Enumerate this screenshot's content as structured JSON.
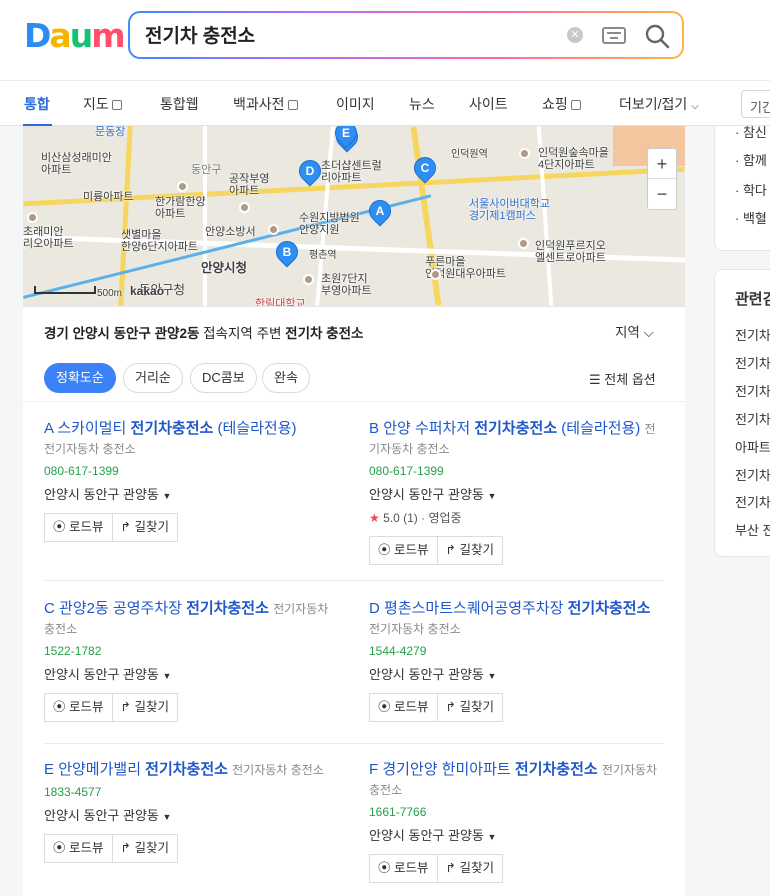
{
  "logo": {
    "text": "Daum"
  },
  "search": {
    "query": "전기차 충전소",
    "clear_icon": "close-icon",
    "keyboard_icon": "keyboard-icon",
    "search_icon": "search-icon"
  },
  "tabs": [
    {
      "label": "통합"
    },
    {
      "label": "지도"
    },
    {
      "label": "통합웹"
    },
    {
      "label": "백과사전"
    },
    {
      "label": "이미지"
    },
    {
      "label": "뉴스"
    },
    {
      "label": "사이트"
    },
    {
      "label": "쇼핑"
    },
    {
      "label": "더보기/접기"
    }
  ],
  "period": {
    "label": "기간"
  },
  "map": {
    "labels": {
      "l1": "문동장",
      "l2": "비산삼성래미안",
      "l2b": "아파트",
      "l3": "동안구",
      "l4": "미륭아파트",
      "l5": "초래미안",
      "l5b": "리오아파트",
      "l6": "한가람한양",
      "l6b": "아파트",
      "l7": "공작부영",
      "l7b": "아파트",
      "l8": "샛별마을",
      "l8b": "한양6단지아파트",
      "l9": "안양소방서",
      "l10": "수원지방법원",
      "l10b": "안양지원",
      "l11": "안양시청",
      "l12": "동안구청",
      "l13": "초원7단지",
      "l13b": "부영아파트",
      "l14": "평촌역",
      "l15": "인덕원역",
      "l16": "인덕원숲속마을",
      "l16b": "4단지아파트",
      "l17": "서울사이버대학교",
      "l17b": "경기제1캠퍼스",
      "l18": "인덕원푸르지오",
      "l18b": "엘센트로아파트",
      "l19": "푸른마을",
      "l19b": "인덕원대우아파트",
      "l20": "초더샵센트럴",
      "l20b": "리아파트",
      "l21": "한림대학교"
    },
    "scale": "500m",
    "brand": "kakao",
    "markers": [
      "A",
      "B",
      "C",
      "D",
      "E"
    ],
    "zoom_in": "+",
    "zoom_out": "−"
  },
  "results": {
    "title_pre": "경기 안양시 동안구 관양2동",
    "title_mid": " 접속지역 주변 ",
    "title_key": "전기차 충전소",
    "area_label": "지역",
    "filters": [
      "정확도순",
      "거리순",
      "DC콤보",
      "완속"
    ],
    "all_options": "전체 옵션",
    "places": [
      {
        "letter": "A",
        "name_pre": "스카이멀티 ",
        "name_key": "전기차충전소",
        "name_post": " (테슬라전용)",
        "category": "전기자동차 충전소",
        "phone": "080-617-1399",
        "address": "안양시 동안구 관양동",
        "rating": "",
        "status": ""
      },
      {
        "letter": "B",
        "name_pre": "안양 수퍼차저 ",
        "name_key": "전기차충전소",
        "name_post": " (테슬라전용)",
        "category": "전기자동차 충전소",
        "phone": "080-617-1399",
        "address": "안양시 동안구 관양동",
        "rating": "5.0 (1)",
        "status": "영업중"
      },
      {
        "letter": "C",
        "name_pre": "관양2동 공영주차장 ",
        "name_key": "전기차충전소",
        "name_post": "",
        "category": "전기자동차 충전소",
        "phone": "1522-1782",
        "address": "안양시 동안구 관양동",
        "rating": "",
        "status": ""
      },
      {
        "letter": "D",
        "name_pre": "평촌스마트스퀘어공영주차장 ",
        "name_key": "전기차충전소",
        "name_post": "",
        "category": "전기자동차 충전소",
        "phone": "1544-4279",
        "address": "안양시 동안구 관양동",
        "rating": "",
        "status": ""
      },
      {
        "letter": "E",
        "name_pre": "안양메가밸리 ",
        "name_key": "전기차충전소",
        "name_post": "",
        "category": "전기자동차 충전소",
        "phone": "1833-4577",
        "address": "안양시 동안구 관양동",
        "rating": "",
        "status": ""
      },
      {
        "letter": "F",
        "name_pre": "경기안양 한미아파트 ",
        "name_key": "전기차충전소",
        "name_post": "",
        "category": "전기자동차 충전소",
        "phone": "1661-7766",
        "address": "안양시 동안구 관양동",
        "rating": "",
        "status": ""
      }
    ],
    "roadview_label": "로드뷰",
    "directions_label": "길찾기"
  },
  "right_panel": {
    "box1": [
      "· 참신",
      "· 함께",
      "· 학다",
      "· 백혈"
    ],
    "related_title": "관련검",
    "related": [
      "전기차",
      "전기차",
      "전기차",
      "전기차",
      "아파트",
      "전기차",
      "전기차",
      "부산 전"
    ]
  }
}
